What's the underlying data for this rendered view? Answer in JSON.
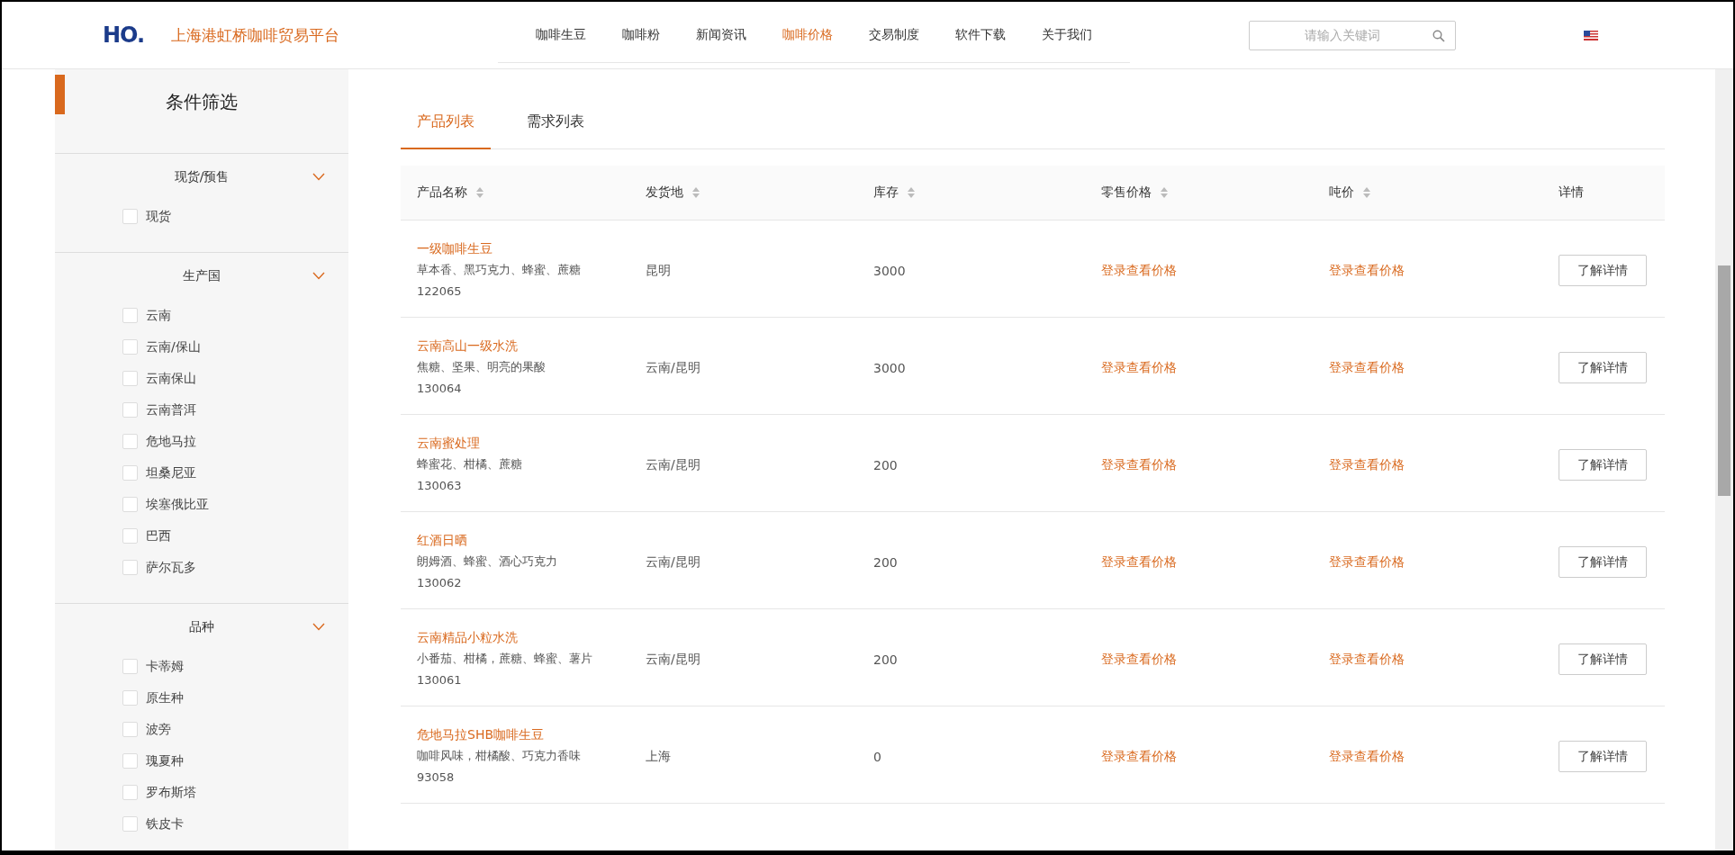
{
  "header": {
    "logo": "HO.",
    "site_name": "上海港虹桥咖啡贸易平台",
    "nav": [
      {
        "label": "咖啡生豆",
        "selected": false
      },
      {
        "label": "咖啡粉",
        "selected": false
      },
      {
        "label": "新闻资讯",
        "selected": false
      },
      {
        "label": "咖啡价格",
        "selected": true
      },
      {
        "label": "交易制度",
        "selected": false
      },
      {
        "label": "软件下载",
        "selected": false
      },
      {
        "label": "关于我们",
        "selected": false
      }
    ],
    "search": {
      "placeholder": "请输入关键词"
    }
  },
  "sidebar": {
    "title": "条件筛选",
    "groups": [
      {
        "title": "现货/预售",
        "expanded": true,
        "items": [
          {
            "label": "现货",
            "checked": false
          }
        ]
      },
      {
        "title": "生产国",
        "expanded": true,
        "items": [
          {
            "label": "云南",
            "checked": false
          },
          {
            "label": "云南/保山",
            "checked": false
          },
          {
            "label": "云南保山",
            "checked": false
          },
          {
            "label": "云南普洱",
            "checked": false
          },
          {
            "label": "危地马拉",
            "checked": false
          },
          {
            "label": "坦桑尼亚",
            "checked": false
          },
          {
            "label": "埃塞俄比亚",
            "checked": false
          },
          {
            "label": "巴西",
            "checked": false
          },
          {
            "label": "萨尔瓦多",
            "checked": false
          }
        ]
      },
      {
        "title": "品种",
        "expanded": true,
        "items": [
          {
            "label": "卡蒂姆",
            "checked": false
          },
          {
            "label": "原生种",
            "checked": false
          },
          {
            "label": "波旁",
            "checked": false
          },
          {
            "label": "瑰夏种",
            "checked": false
          },
          {
            "label": "罗布斯塔",
            "checked": false
          },
          {
            "label": "铁皮卡",
            "checked": false
          }
        ]
      }
    ]
  },
  "tabs": [
    {
      "label": "产品列表",
      "selected": true
    },
    {
      "label": "需求列表",
      "selected": false
    }
  ],
  "table": {
    "columns": [
      {
        "label": "产品名称",
        "sortable": true
      },
      {
        "label": "发货地",
        "sortable": true
      },
      {
        "label": "库存",
        "sortable": true
      },
      {
        "label": "零售价格",
        "sortable": true
      },
      {
        "label": "吨价",
        "sortable": true
      },
      {
        "label": "详情",
        "sortable": false
      }
    ],
    "rows": [
      {
        "name": "一级咖啡生豆",
        "flavor": "草本香、黑巧克力、蜂蜜、蔗糖",
        "code": "122065",
        "origin": "昆明",
        "stock": "3000",
        "retail_price": "登录查看价格",
        "ton_price": "登录查看价格",
        "action": "了解详情"
      },
      {
        "name": "云南高山一级水洗",
        "flavor": "焦糖、坚果、明亮的果酸",
        "code": "130064",
        "origin": "云南/昆明",
        "stock": "3000",
        "retail_price": "登录查看价格",
        "ton_price": "登录查看价格",
        "action": "了解详情"
      },
      {
        "name": "云南蜜处理",
        "flavor": "蜂蜜花、柑橘、蔗糖",
        "code": "130063",
        "origin": "云南/昆明",
        "stock": "200",
        "retail_price": "登录查看价格",
        "ton_price": "登录查看价格",
        "action": "了解详情"
      },
      {
        "name": "红酒日晒",
        "flavor": "朗姆酒、蜂蜜、酒心巧克力",
        "code": "130062",
        "origin": "云南/昆明",
        "stock": "200",
        "retail_price": "登录查看价格",
        "ton_price": "登录查看价格",
        "action": "了解详情"
      },
      {
        "name": "云南精品小粒水洗",
        "flavor": "小番茄、柑橘，蔗糖、蜂蜜、薯片",
        "code": "130061",
        "origin": "云南/昆明",
        "stock": "200",
        "retail_price": "登录查看价格",
        "ton_price": "登录查看价格",
        "action": "了解详情"
      },
      {
        "name": "危地马拉SHB咖啡生豆",
        "flavor": "咖啡风味，柑橘酸、巧克力香味",
        "code": "93058",
        "origin": "上海",
        "stock": "0",
        "retail_price": "登录查看价格",
        "ton_price": "登录查看价格",
        "action": "了解详情"
      }
    ]
  }
}
